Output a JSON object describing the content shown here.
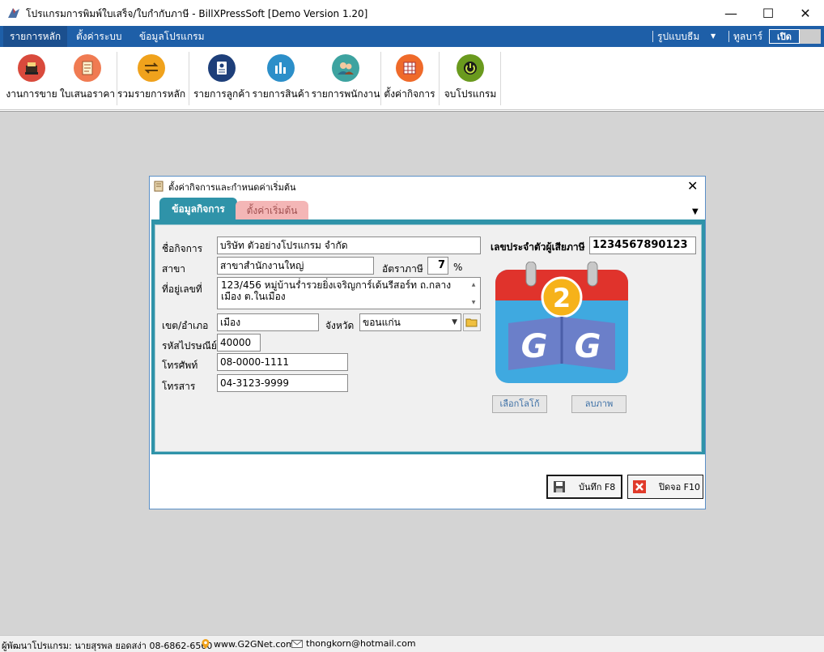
{
  "window": {
    "title": "โปรแกรมการพิมพ์ใบเสร็จ/ใบกำกับภาษี - BillXPressSoft [Demo Version 1.20]",
    "min_glyph": "—",
    "max_glyph": "☐",
    "close_glyph": "✕"
  },
  "menu": {
    "tabs": [
      "รายการหลัก",
      "ตั้งค่าระบบ",
      "ข้อมูลโปรแกรม"
    ],
    "theme_label": "รูปแบบธีม",
    "theme_arrow": "▼",
    "toolbar_label": "ทูลบาร์",
    "toggle_label": "เปิด"
  },
  "ribbon": {
    "buttons": [
      {
        "label": "งานการขาย",
        "icon": "cash-register-icon",
        "color": "#d94a3c"
      },
      {
        "label": "ใบเสนอราคา",
        "icon": "document-icon",
        "color": "#f07b52"
      },
      {
        "label": "รวมรายการหลัก",
        "icon": "swap-icon",
        "color": "#f0a21c"
      },
      {
        "label": "รายการลูกค้า",
        "icon": "customer-card-icon",
        "color": "#1e3f7a"
      },
      {
        "label": "รายการสินค้า",
        "icon": "products-icon",
        "color": "#2c8fc9"
      },
      {
        "label": "รายการพนักงาน",
        "icon": "employees-icon",
        "color": "#3da3a0"
      },
      {
        "label": "ตั้งค่ากิจการ",
        "icon": "business-settings-icon",
        "color": "#ef6a2a"
      },
      {
        "label": "จบโปรแกรม",
        "icon": "power-icon",
        "color": "#6a9a1e"
      }
    ]
  },
  "dialog": {
    "title": "ตั้งค่ากิจการและกำหนดค่าเริ่มต้น",
    "close_glyph": "✕",
    "tabs": {
      "active": "ข้อมูลกิจการ",
      "inactive": "ตั้งค่าเริ่มต้น"
    },
    "tab_menu_arrow": "▼",
    "form": {
      "business_name_label": "ชื่อกิจการ",
      "business_name": "บริษัท ตัวอย่างโปรแกรม จำกัด",
      "branch_label": "สาขา",
      "branch": "สาขาสำนักงานใหญ่",
      "tax_rate_label": "อัตราภาษี",
      "tax_rate": "7",
      "tax_rate_unit": "%",
      "address_label": "ที่อยู่เลขที่",
      "address": "123/456 หมู่บ้านร่ำรวยยิ่งเจริญการ์เด้นรีสอร์ท ถ.กลางเมือง ต.ในเมือง",
      "district_label": "เขต/อำเภอ",
      "district": "เมือง",
      "province_label": "จังหวัด",
      "province": "ขอนแก่น",
      "postcode_label": "รหัสไปรษณีย์",
      "postcode": "40000",
      "phone_label": "โทรศัพท์",
      "phone": "08-0000-1111",
      "fax_label": "โทรสาร",
      "fax": "04-3123-9999",
      "tax_id_label": "เลขประจำตัวผู้เสียภาษี",
      "tax_id": "1234567890123"
    },
    "logo": {
      "text_top": "2",
      "text_left": "G",
      "text_right": "G"
    },
    "choose_logo_button": "เลือกโลโก้",
    "delete_image_button": "ลบภาพ",
    "save_button": "บันทึก F8",
    "close_button": "ปิดจอ F10"
  },
  "status": {
    "developer": "ผู้พัฒนาโปรแกรม: นายสุรพล ยอดสง่า 08-6862-6560",
    "website": "www.G2GNet.com",
    "email": "thongkorn@hotmail.com"
  },
  "colors": {
    "accent": "#1e5fa8",
    "dialog_tab": "#2f93a9",
    "inactive_tab": "#f4b6b6"
  }
}
